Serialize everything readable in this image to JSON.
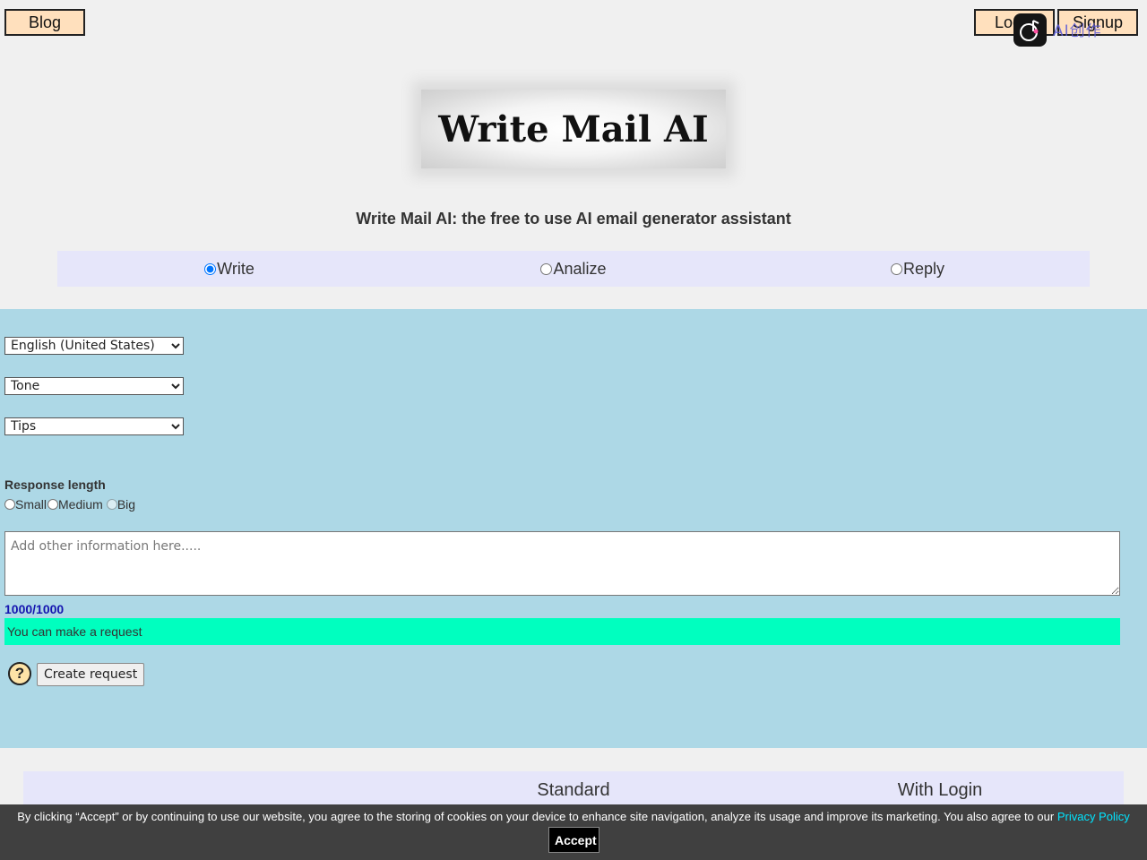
{
  "header": {
    "blog_label": "Blog",
    "login_label": "Login",
    "signup_label": "Signup",
    "overlay_badge_text": "AI创作"
  },
  "logo": {
    "text": "Write Mail AI"
  },
  "tagline": "Write Mail AI: the free to use AI email generator assistant",
  "modes": {
    "items": [
      {
        "label": "Write",
        "checked": true
      },
      {
        "label": "Analize",
        "checked": false
      },
      {
        "label": "Reply",
        "checked": false
      }
    ]
  },
  "form": {
    "language": {
      "selected": "English (United States)"
    },
    "tone": {
      "selected": "Tone"
    },
    "tips": {
      "selected": "Tips"
    },
    "response_length": {
      "label": "Response length",
      "options": [
        "Small",
        "Medium",
        "Big"
      ]
    },
    "info_placeholder": "Add other information here.....",
    "counter": "1000/1000",
    "status": "You can make a request",
    "help_icon_symbol": "?",
    "create_label": "Create request"
  },
  "pricing": {
    "columns": [
      "Standard",
      "With Login"
    ]
  },
  "cookie": {
    "text": "By clicking “Accept” or by continuing to use our website, you agree to the storing of cookies on your device to enhance site navigation, analyze its usage and improve its marketing. You also agree to our",
    "link_label": "Privacy Policy",
    "accept_label": "Accept"
  },
  "colors": {
    "header_button_bg": "#ffe0bd",
    "mode_bar_bg": "#e6e6fa",
    "main_bg": "#add8e6",
    "status_bg": "#00ffbf",
    "counter_color": "#1515b0",
    "cookie_bg": "#404040",
    "cookie_link": "#00e5ff"
  }
}
